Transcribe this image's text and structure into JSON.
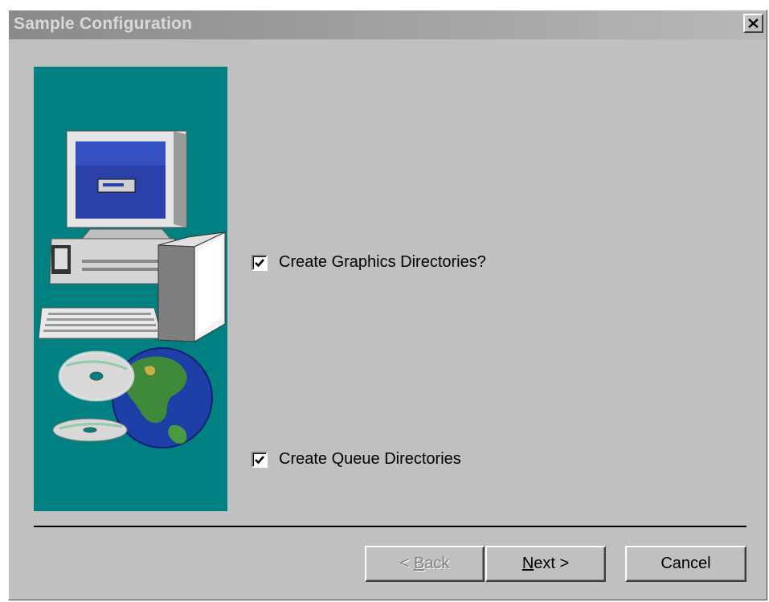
{
  "window": {
    "title": "Sample Configuration",
    "close_glyph": "✕"
  },
  "options": {
    "graphics": {
      "label": "Create Graphics Directories?",
      "checked": true
    },
    "queue": {
      "label": "Create Queue Directories",
      "checked": true
    }
  },
  "buttons": {
    "back": {
      "prefix": "< ",
      "mnemonic": "B",
      "rest": "ack",
      "enabled": false
    },
    "next": {
      "mnemonic": "N",
      "rest": "ext >",
      "enabled": true
    },
    "cancel": {
      "label": "Cancel",
      "enabled": true
    }
  },
  "illustration": {
    "description_icons": [
      "computer-icon",
      "software-box-icon",
      "cd-disc-icon",
      "globe-icon"
    ]
  },
  "colors": {
    "dialog_bg": "#c0c0c0",
    "illustration_bg": "#008080",
    "title_text": "#d8d8d8"
  }
}
